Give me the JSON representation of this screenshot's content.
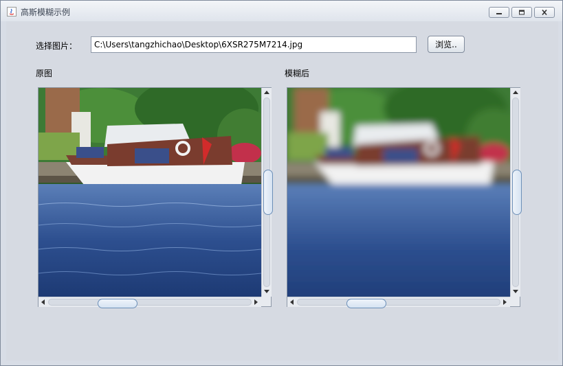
{
  "window": {
    "title": "高斯模糊示例"
  },
  "form": {
    "select_label": "选择图片：",
    "path_value": "C:\\Users\\tangzhichao\\Desktop\\6XSR275M7214.jpg",
    "browse_label": "浏览.."
  },
  "panels": {
    "original_label": "原图",
    "blurred_label": "模糊后"
  },
  "original_pane": {
    "vscroll_fraction": 0.5,
    "hscroll_fraction": 0.3
  },
  "blurred_pane": {
    "vscroll_fraction": 0.5,
    "hscroll_fraction": 0.3
  },
  "colors": {
    "window_bg": "#d6dae2",
    "scroll_thumb_border": "#6c8fb8"
  }
}
